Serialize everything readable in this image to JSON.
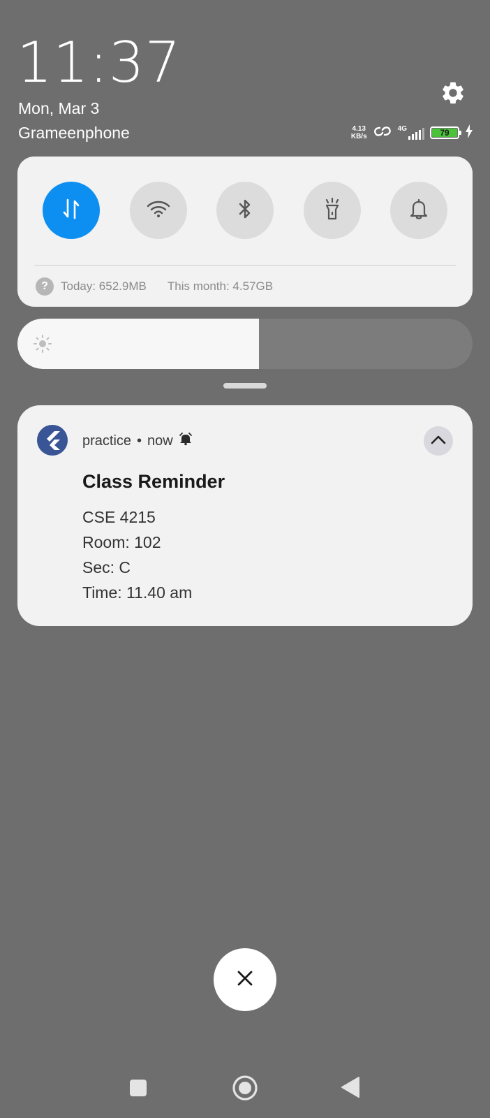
{
  "lockscreen": {
    "time": "11:37",
    "date": "Mon, Mar 3",
    "carrier": "Grameenphone"
  },
  "status_bar": {
    "net_speed_value": "4.13",
    "net_speed_unit": "KB/s",
    "network_type": "4G",
    "signal_bars": 4,
    "battery_percent": "79",
    "charging": true,
    "battery_color": "#4bc23a"
  },
  "quick_settings": {
    "toggles": [
      {
        "name": "mobile-data",
        "icon": "data-arrows-icon",
        "active": true
      },
      {
        "name": "wifi",
        "icon": "wifi-icon",
        "active": false
      },
      {
        "name": "bluetooth",
        "icon": "bluetooth-icon",
        "active": false
      },
      {
        "name": "flashlight",
        "icon": "flashlight-icon",
        "active": false
      },
      {
        "name": "notifications",
        "icon": "bell-icon",
        "active": false
      }
    ],
    "usage_today": "Today: 652.9MB",
    "usage_month": "This month: 4.57GB",
    "accent_color": "#0d8ff2"
  },
  "brightness": {
    "level": 0.53
  },
  "notification": {
    "app_name": "practice",
    "separator": "•",
    "time": "now",
    "title": "Class Reminder",
    "lines": [
      "CSE 4215",
      "Room: 102",
      "Sec: C",
      "Time: 11.40 am"
    ]
  }
}
